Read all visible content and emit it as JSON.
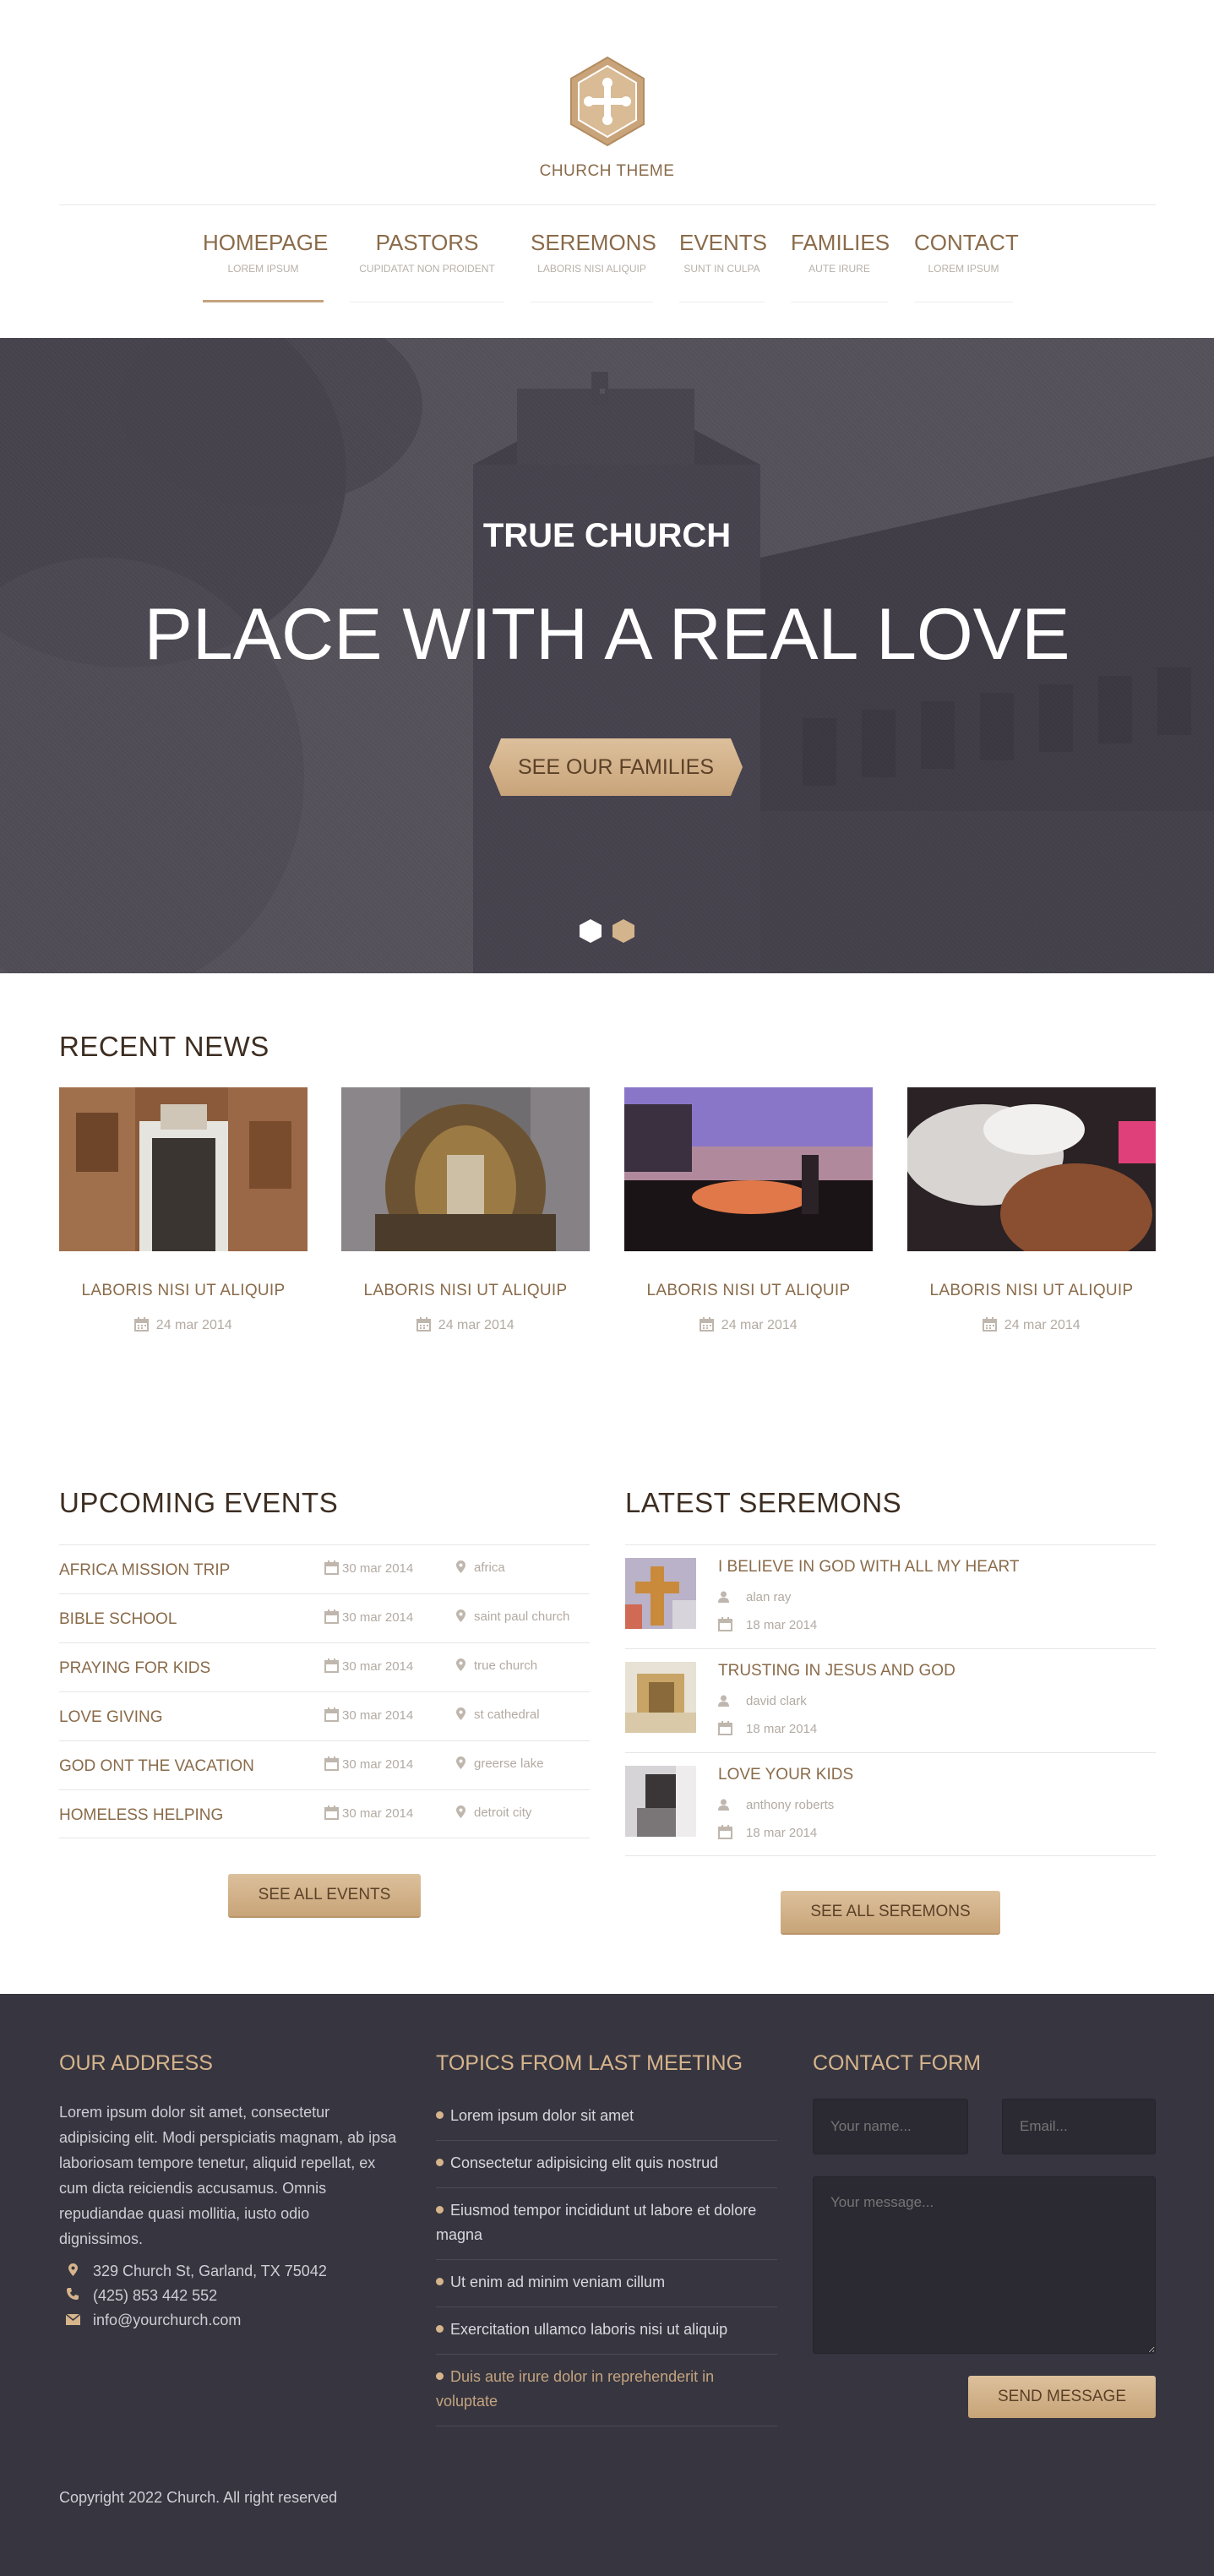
{
  "brand": {
    "name": "CHURCH THEME"
  },
  "nav": [
    {
      "label": "HOMEPAGE",
      "sub": "LOREM IPSUM",
      "active": true
    },
    {
      "label": "PASTORS",
      "sub": "CUPIDATAT NON PROIDENT",
      "active": false
    },
    {
      "label": "SEREMONS",
      "sub": "LABORIS NISI ALIQUIP",
      "active": false
    },
    {
      "label": "EVENTS",
      "sub": "SUNT IN CULPA",
      "active": false
    },
    {
      "label": "FAMILIES",
      "sub": "AUTE IRURE",
      "active": false
    },
    {
      "label": "CONTACT",
      "sub": "LOREM IPSUM",
      "active": false
    }
  ],
  "hero": {
    "kicker": "TRUE CHURCH",
    "title": "PLACE WITH A REAL LOVE",
    "button": "SEE OUR FAMILIES"
  },
  "news": {
    "title": "RECENT NEWS",
    "items": [
      {
        "title": "LABORIS NISI UT ALIQUIP",
        "date": "24 mar 2014"
      },
      {
        "title": "LABORIS NISI UT ALIQUIP",
        "date": "24 mar 2014"
      },
      {
        "title": "LABORIS NISI UT ALIQUIP",
        "date": "24 mar 2014"
      },
      {
        "title": "LABORIS NISI UT ALIQUIP",
        "date": "24 mar 2014"
      }
    ]
  },
  "events": {
    "title": "UPCOMING EVENTS",
    "items": [
      {
        "name": "AFRICA MISSION TRIP",
        "date": "30 mar 2014",
        "location": "africa"
      },
      {
        "name": "BIBLE SCHOOL",
        "date": "30 mar 2014",
        "location": "saint paul church"
      },
      {
        "name": "PRAYING FOR KIDS",
        "date": "30 mar 2014",
        "location": "true church"
      },
      {
        "name": "LOVE GIVING",
        "date": "30 mar 2014",
        "location": "st cathedral"
      },
      {
        "name": "GOD ONT THE VACATION",
        "date": "30 mar 2014",
        "location": "greerse lake"
      },
      {
        "name": "HOMELESS HELPING",
        "date": "30 mar 2014",
        "location": "detroit city"
      }
    ],
    "button": "SEE ALL EVENTS"
  },
  "sermons": {
    "title": "LATEST SEREMONS",
    "items": [
      {
        "title": "I BELIEVE IN GOD WITH ALL MY HEART",
        "author": "alan ray",
        "date": "18 mar 2014"
      },
      {
        "title": "TRUSTING IN JESUS AND GOD",
        "author": "david clark",
        "date": "18 mar 2014"
      },
      {
        "title": "LOVE YOUR KIDS",
        "author": "anthony roberts",
        "date": "18 mar 2014"
      }
    ],
    "button": "SEE ALL SEREMONS"
  },
  "footer": {
    "address": {
      "title": "OUR ADDRESS",
      "text": "Lorem ipsum dolor sit amet, consectetur adipisicing elit. Modi perspiciatis magnam, ab ipsa laboriosam tempore tenetur, aliquid repellat, ex cum dicta reiciendis accusamus. Omnis repudiandae quasi mollitia, iusto odio dignissimos.",
      "street": "329 Church St, Garland, TX 75042",
      "phone": "(425) 853 442 552",
      "email": "info@yourchurch.com"
    },
    "topics": {
      "title": "TOPICS FROM LAST MEETING",
      "items": [
        "Lorem ipsum dolor sit amet",
        "Consectetur adipisicing elit quis nostrud",
        "Eiusmod tempor incididunt ut labore et dolore magna",
        "Ut enim ad minim veniam cillum",
        "Exercitation ullamco laboris nisi ut aliquip",
        "Duis aute irure dolor in reprehenderit in voluptate"
      ]
    },
    "form": {
      "title": "CONTACT FORM",
      "name_placeholder": "Your name...",
      "email_placeholder": "Email...",
      "message_placeholder": "Your message...",
      "button": "SEND MESSAGE"
    },
    "copyright": "Copyright 2022 Church. All right reserved"
  },
  "colors": {
    "accent": "#c4a37f",
    "brown_text": "#8a6b4a",
    "footer_bg": "#373640",
    "hero_overlay": "#5a5860"
  }
}
